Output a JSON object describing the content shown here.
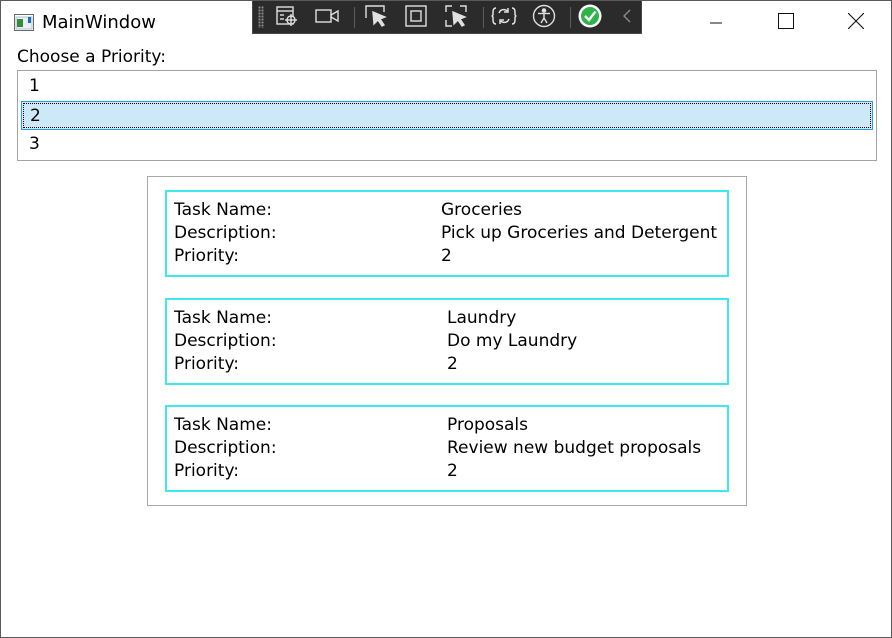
{
  "window": {
    "title": "MainWindow"
  },
  "prompt": {
    "label": "Choose a Priority:"
  },
  "priorities": {
    "items": [
      "1",
      "2",
      "3"
    ],
    "selected_value": "2"
  },
  "task_labels": {
    "name": "Task Name:",
    "description": "Description:",
    "priority": "Priority:"
  },
  "tasks": [
    {
      "name": "Groceries",
      "description": "Pick up Groceries and Detergent",
      "priority": "2"
    },
    {
      "name": "Laundry",
      "description": "Do my Laundry",
      "priority": "2"
    },
    {
      "name": "Proposals",
      "description": "Review new budget proposals",
      "priority": "2"
    }
  ],
  "colors": {
    "selection_fill": "#cde8f7",
    "selection_border": "#26a0da",
    "card_border": "#3ee8f0",
    "toolbar_bg": "#2b2b2b",
    "toolbar_check": "#2fb34a"
  },
  "icons": {
    "app": "app-window-icon",
    "minimize": "minimize-icon",
    "maximize": "maximize-icon",
    "close": "close-icon",
    "toolbar": [
      "live-visual-tree-icon",
      "record-video-icon",
      "select-element-icon",
      "display-layout-adorners-icon",
      "track-focused-element-icon",
      "hot-reload-icon",
      "accessibility-icon",
      "hot-reload-status-check-icon",
      "collapse-toolbar-chevron-icon"
    ]
  }
}
